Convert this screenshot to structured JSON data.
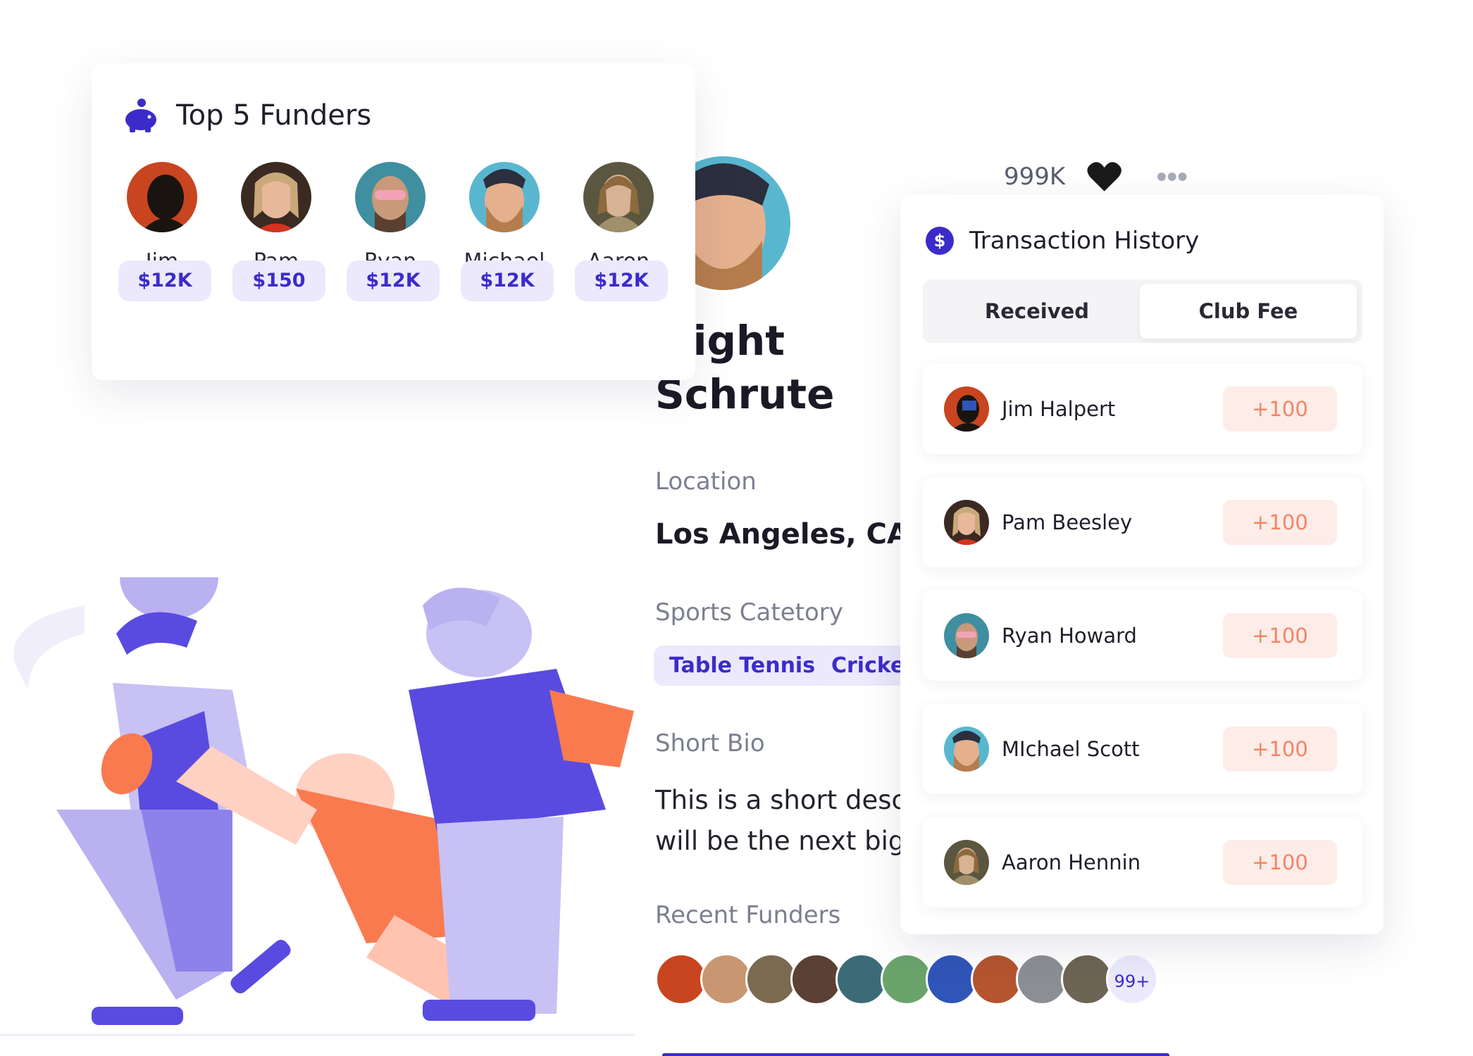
{
  "funders_card": {
    "title": "Top 5 Funders",
    "funders": [
      {
        "name": "Jim",
        "amount": "$12K"
      },
      {
        "name": "Pam",
        "amount": "$150"
      },
      {
        "name": "Ryan",
        "amount": "$12K"
      },
      {
        "name": "Michael",
        "amount": "$12K"
      },
      {
        "name": "Aaron",
        "amount": "$12K"
      }
    ]
  },
  "profile": {
    "name_line1": "wight",
    "name_line2": "Schrute",
    "location_label": "Location",
    "location_value": "Los Angeles, CA",
    "sports_label": "Sports Catetory",
    "sports": [
      "Table Tennis",
      "Cricket"
    ],
    "bio_label": "Short Bio",
    "bio_line1": "This is a short descr",
    "bio_line2": "will be the next big s",
    "recent_label": "Recent Funders",
    "recent_more": "99+",
    "likes": "999K"
  },
  "transactions": {
    "title": "Transaction History",
    "tabs": [
      "Received",
      "Club Fee"
    ],
    "items": [
      {
        "name": "Jim Halpert",
        "amount": "+100"
      },
      {
        "name": "Pam Beesley",
        "amount": "+100"
      },
      {
        "name": "Ryan Howard",
        "amount": "+100"
      },
      {
        "name": "MIchael Scott",
        "amount": "+100"
      },
      {
        "name": "Aaron Hennin",
        "amount": "+100"
      }
    ]
  },
  "colors": {
    "accent": "#3b2cc9",
    "accent_light": "#ebe9fb",
    "positive_bg": "#fdece8",
    "positive_text": "#f58464",
    "illustration_orange": "#fa7a4f",
    "illustration_purple": "#5a4be0"
  },
  "icons": {
    "funders": "piggy-bank-icon",
    "transactions": "dollar-icon",
    "like": "heart-icon",
    "more": "more-dots-icon"
  }
}
